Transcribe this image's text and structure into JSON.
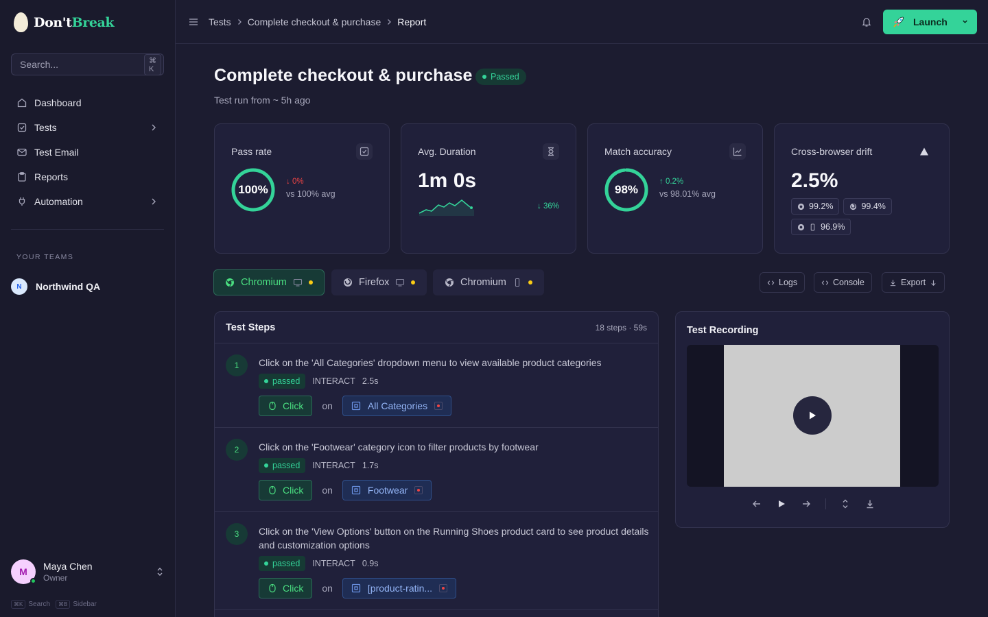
{
  "app": {
    "logo_prefix": "Don't",
    "logo_accent": "Break"
  },
  "sidebar": {
    "search_placeholder": "Search...",
    "search_kbd": "⌘ K",
    "items": [
      {
        "label": "Dashboard",
        "icon": "home-icon"
      },
      {
        "label": "Tests",
        "icon": "check-square-icon"
      },
      {
        "label": "Test Email",
        "icon": "mail-icon"
      },
      {
        "label": "Reports",
        "icon": "clipboard-icon"
      },
      {
        "label": "Automation",
        "icon": "plug-icon"
      }
    ],
    "teams_label": "YOUR TEAMS",
    "team": {
      "initial": "N",
      "name": "Northwind QA"
    },
    "user": {
      "initial": "M",
      "name": "Maya Chen",
      "role": "Owner"
    },
    "shortcuts": [
      {
        "kbd": "⌘K",
        "label": "Search"
      },
      {
        "kbd": "⌘B",
        "label": "Sidebar"
      }
    ]
  },
  "header": {
    "breadcrumbs": [
      "Tests",
      "Complete checkout & purchase",
      "Report"
    ],
    "launch_label": "Launch"
  },
  "page": {
    "title": "Complete checkout & purchase",
    "status": "Passed",
    "subtitle": "Test run from ~ 5h ago"
  },
  "stats": {
    "pass_rate": {
      "title": "Pass rate",
      "value": "100%",
      "fraction": 1.0,
      "delta": "↓ 0%",
      "vs": "vs 100% avg"
    },
    "duration": {
      "title": "Avg. Duration",
      "value": "1m 0s",
      "delta": "↓ 36%"
    },
    "accuracy": {
      "title": "Match accuracy",
      "value": "98%",
      "fraction": 0.98,
      "delta": "↑ 0.2%",
      "vs": "vs 98.01% avg"
    },
    "drift": {
      "title": "Cross-browser drift",
      "value": "2.5%",
      "chips": [
        "99.2%",
        "99.4%",
        "96.9%"
      ]
    }
  },
  "browser_tabs": [
    {
      "label": "Chromium",
      "device": "desktop"
    },
    {
      "label": "Firefox",
      "device": "desktop"
    },
    {
      "label": "Chromium",
      "device": "mobile"
    }
  ],
  "tools": {
    "logs": "Logs",
    "console": "Console",
    "export": "Export"
  },
  "steps_panel": {
    "title": "Test Steps",
    "count": "18 steps",
    "duration": "· 59s",
    "steps": [
      {
        "num": "1",
        "desc": "Click on the 'All Categories' dropdown menu to view available product categories",
        "status": "passed",
        "type": "INTERACT",
        "time": "2.5s",
        "action": "Click",
        "on": "on",
        "target": "All Categories"
      },
      {
        "num": "2",
        "desc": "Click on the 'Footwear' category icon to filter products by footwear",
        "status": "passed",
        "type": "INTERACT",
        "time": "1.7s",
        "action": "Click",
        "on": "on",
        "target": "Footwear"
      },
      {
        "num": "3",
        "desc": "Click on the 'View Options' button on the Running Shoes product card to see product details and customization options",
        "status": "passed",
        "type": "INTERACT",
        "time": "0.9s",
        "action": "Click",
        "on": "on",
        "target": "[product-ratin..."
      }
    ]
  },
  "recording": {
    "title": "Test Recording"
  },
  "colors": {
    "accent": "#34d399",
    "danger": "#ef4444",
    "warning": "#facc15",
    "background": "#1c1c30"
  }
}
